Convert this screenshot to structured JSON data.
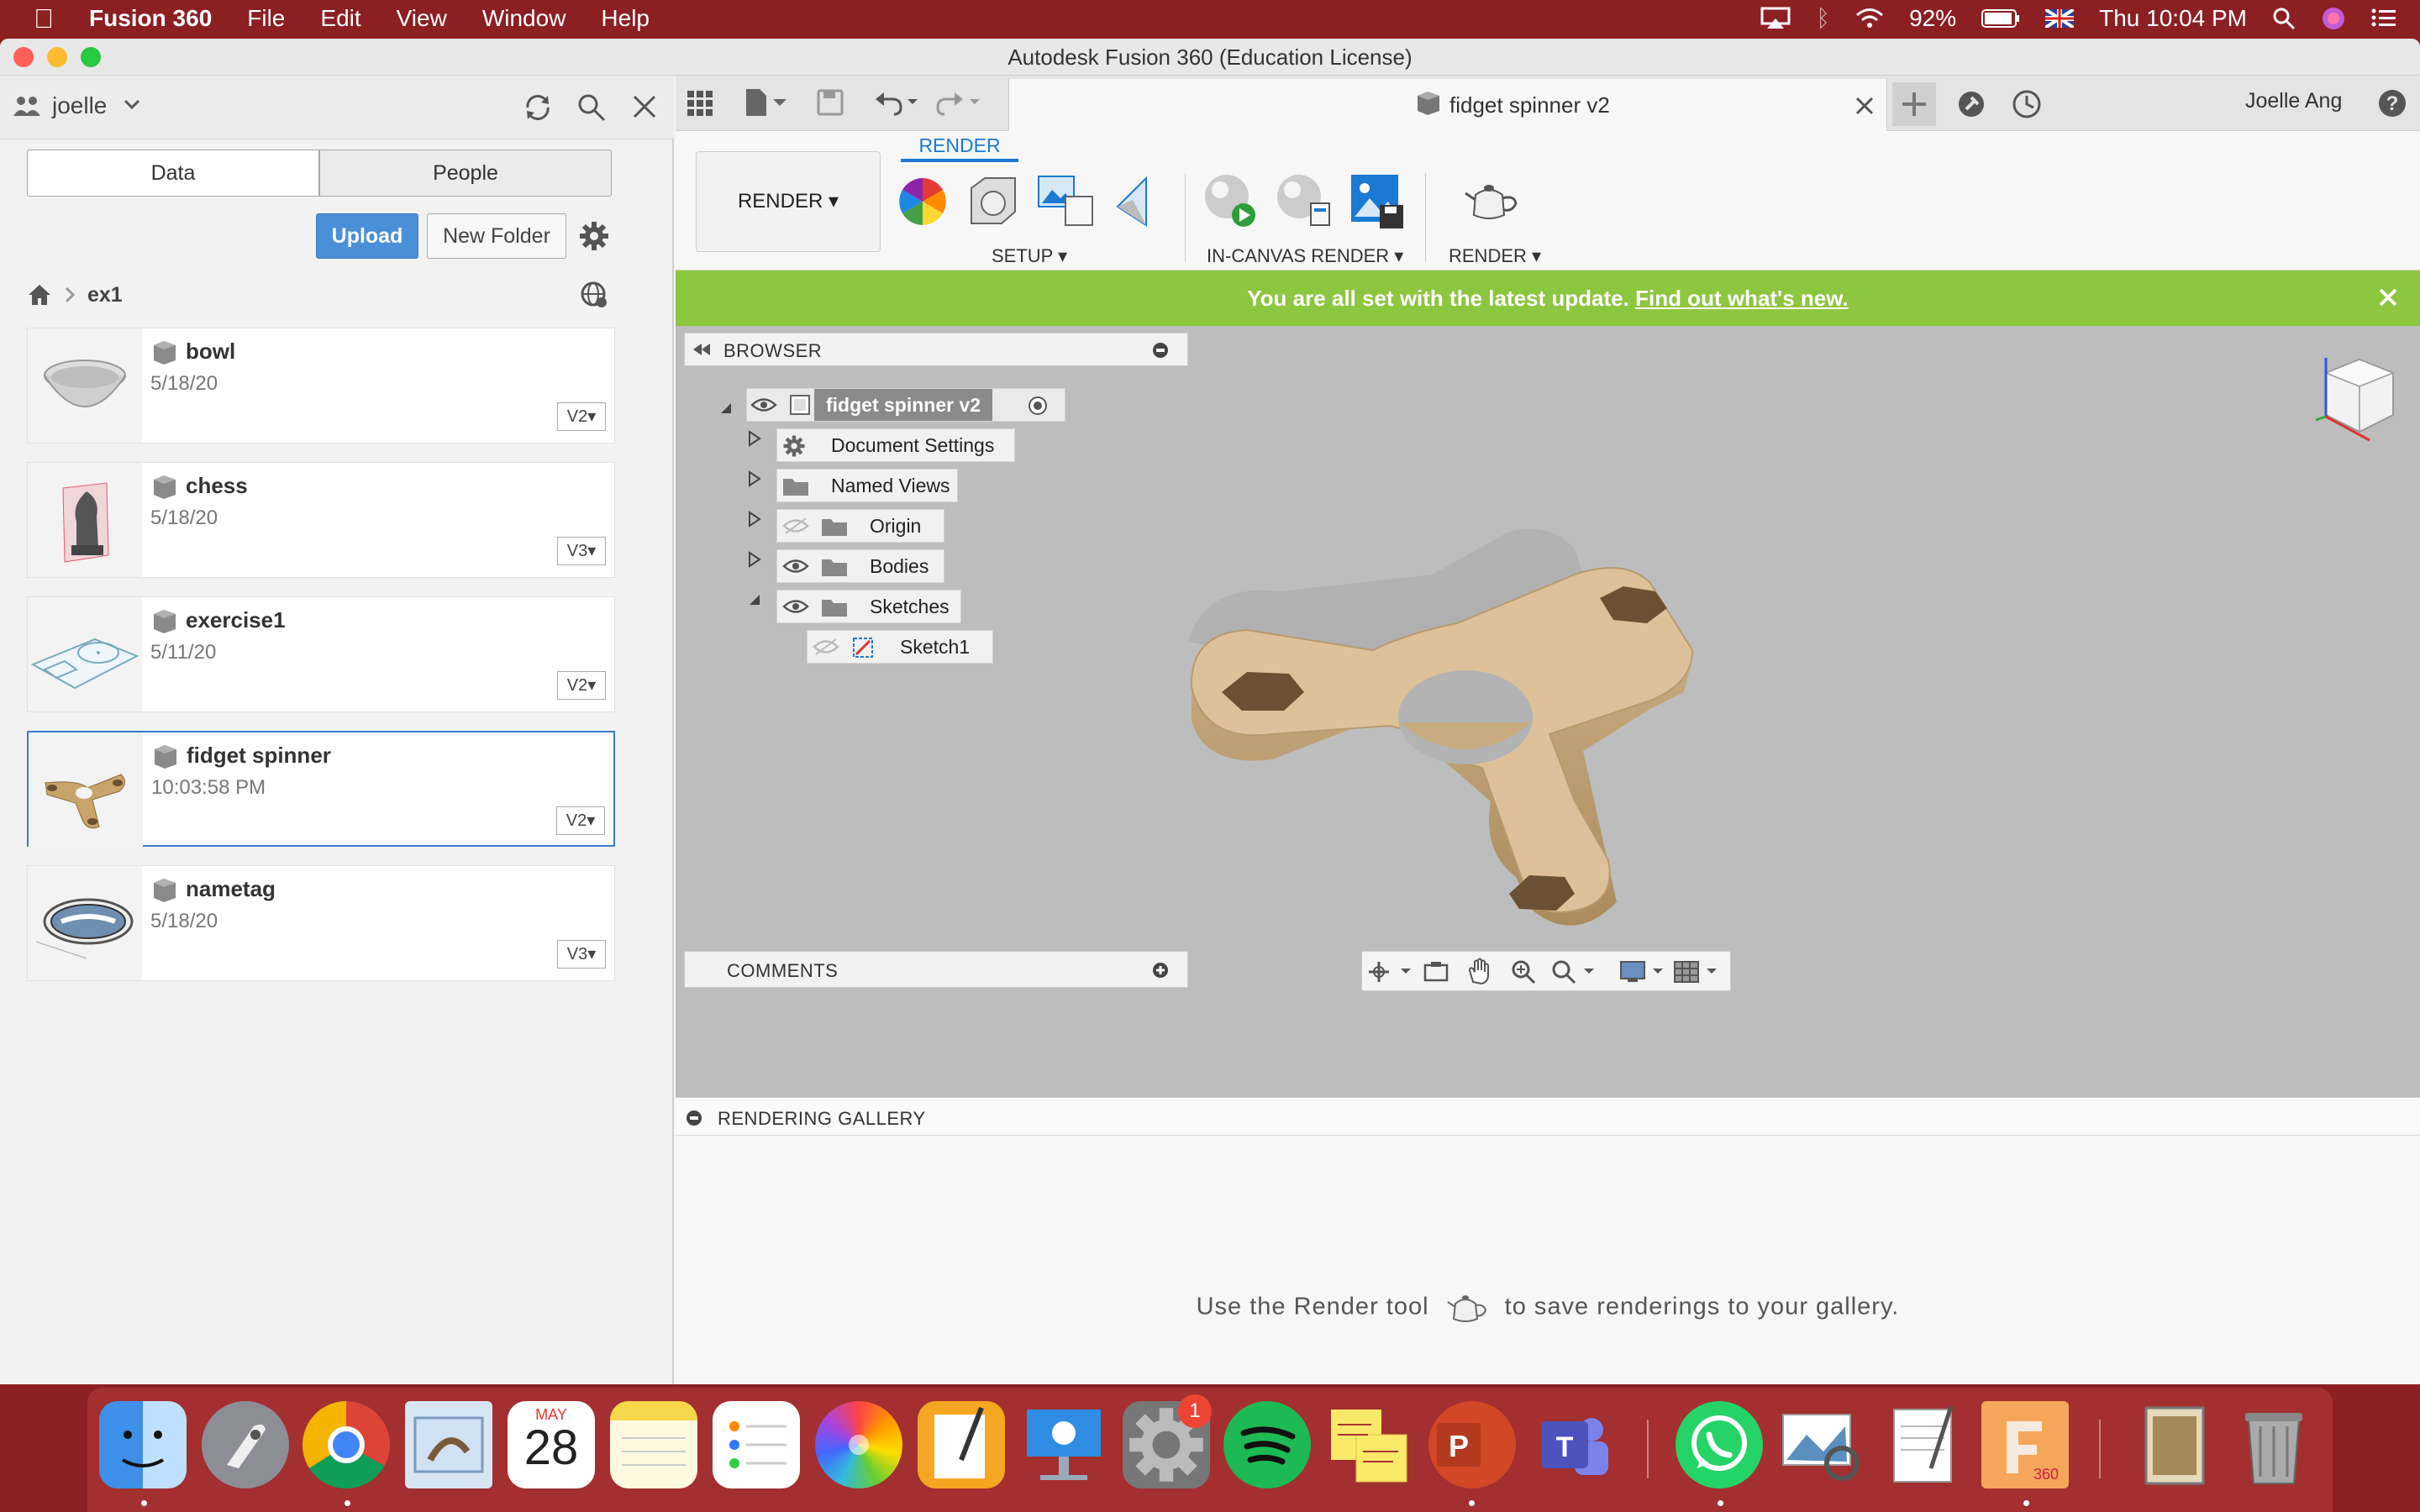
{
  "menubar": {
    "app_name": "Fusion 360",
    "menus": [
      "File",
      "Edit",
      "View",
      "Window",
      "Help"
    ],
    "battery": "92%",
    "clock": "Thu 10:04 PM"
  },
  "window": {
    "title": "Autodesk Fusion 360 (Education License)"
  },
  "left_panel": {
    "user": "joelle",
    "tabs": {
      "data": "Data",
      "people": "People"
    },
    "upload_label": "Upload",
    "new_folder_label": "New Folder",
    "breadcrumb": "ex1",
    "files": [
      {
        "name": "bowl",
        "date": "5/18/20",
        "version": "V2"
      },
      {
        "name": "chess",
        "date": "5/18/20",
        "version": "V3"
      },
      {
        "name": "exercise1",
        "date": "5/11/20",
        "version": "V2"
      },
      {
        "name": "fidget spinner",
        "date": "10:03:58 PM",
        "version": "V2"
      },
      {
        "name": "nametag",
        "date": "5/18/20",
        "version": "V3"
      }
    ]
  },
  "doc_tab": {
    "title": "fidget spinner v2"
  },
  "user_name": "Joelle Ang",
  "toolbar": {
    "workspace": "RENDER",
    "active_tab": "RENDER",
    "groups": {
      "setup": "SETUP",
      "in_canvas": "IN-CANVAS RENDER",
      "render": "RENDER"
    }
  },
  "notification": {
    "text": "You are all set with the latest update.",
    "link": "Find out what's new."
  },
  "browser": {
    "title": "BROWSER",
    "root": "fidget spinner v2",
    "nodes": [
      "Document Settings",
      "Named Views",
      "Origin",
      "Bodies",
      "Sketches"
    ],
    "child": "Sketch1"
  },
  "comments_label": "COMMENTS",
  "gallery": {
    "title": "RENDERING GALLERY",
    "message_before": "Use the Render tool",
    "message_after": "to save renderings to your gallery."
  },
  "dock": {
    "calendar_month": "MAY",
    "calendar_day": "28",
    "settings_badge": "1",
    "fusion_label": "360"
  },
  "colors": {
    "menubar": "#8b1f22",
    "accent_blue": "#1a7ad4",
    "notification_green": "#8dc63f",
    "spinner_body": "#d8bc92",
    "viewport_bg": "#bdbdbd"
  }
}
